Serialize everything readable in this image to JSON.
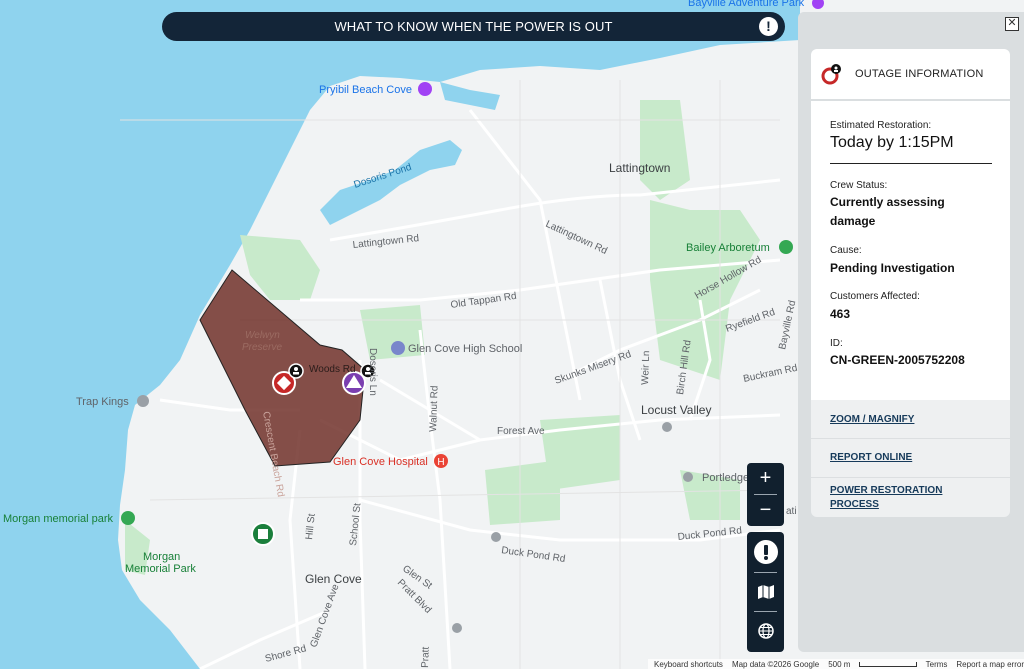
{
  "banner": {
    "text": "WHAT TO KNOW WHEN THE POWER IS OUT",
    "icon": "alert-icon"
  },
  "panel": {
    "close_icon": "close-icon",
    "header_icon": "outage-icon",
    "title": "OUTAGE INFORMATION",
    "estimated_label": "Estimated Restoration:",
    "estimated_value": "Today by 1:15PM",
    "crew_label": "Crew Status:",
    "crew_value": "Currently assessing damage",
    "cause_label": "Cause:",
    "cause_value": "Pending Investigation",
    "customers_label": "Customers Affected:",
    "customers_value": "463",
    "id_label": "ID:",
    "id_value": "CN-GREEN-2005752208",
    "links": [
      "ZOOM / MAGNIFY",
      "REPORT ONLINE",
      "POWER RESTORATION PROCESS"
    ]
  },
  "controls": {
    "zoom_in": "+",
    "zoom_out": "−",
    "tools": [
      "alert-icon",
      "map-layers-icon",
      "globe-icon"
    ]
  },
  "map": {
    "places": {
      "lattingtown": "Lattingtown",
      "locust_valley": "Locust Valley",
      "glen_cove": "Glen Cove",
      "portledge": "Portledge"
    },
    "pois": {
      "pryibil": "Pryibil Beach Cove",
      "bayville": "Bayville Adventure Park",
      "high_school": "Glen Cove High School",
      "hospital": "Glen Cove Hospital",
      "trap_kings": "Trap Kings",
      "morgan_park": "Morgan memorial park",
      "morgan_memorial_1": "Morgan",
      "morgan_memorial_2": "Memorial Park",
      "bailey_arboretum": "Bailey Arboretum",
      "welwyn_1": "Welwyn",
      "welwyn_2": "Preserve",
      "dosoris_pond": "Dosoris Pond"
    },
    "roads": {
      "lattingtown_rd": "Lattingtown Rd",
      "lattingtown_rd2": "Lattingtown Rd",
      "old_tappan": "Old Tappan Rd",
      "skunks_misery": "Skunks Misery Rd",
      "horse_hollow": "Horse Hollow Rd",
      "ryefield": "Ryefield Rd",
      "bayville_rd": "Bayville Rd",
      "buckram": "Buckram Rd",
      "birch_hill": "Birch Hill Rd",
      "weir_ln": "Weir Ln",
      "forest_ave": "Forest Ave",
      "walnut_rd": "Walnut Rd",
      "duck_pond_1": "Duck Pond Rd",
      "duck_pond_2": "Duck Pond Rd",
      "school_st": "School St",
      "hill_st": "Hill St",
      "glen_st": "Glen St",
      "pratt_blvd": "Pratt Blvd",
      "glen_cove_ave": "Glen Cove Ave",
      "shore_rd": "Shore Rd",
      "crescent_beach": "Crescent Beach Rd",
      "woods_rd": "Woods Rd",
      "dosoris_ln": "Dosoris Ln",
      "pratt": "Pratt",
      "ati": "ati"
    }
  },
  "attribution": {
    "shortcuts": "Keyboard shortcuts",
    "data": "Map data ©2026 Google",
    "scale": "500 m",
    "terms": "Terms",
    "report": "Report a map error"
  },
  "colors": {
    "water": "#8fd3ee",
    "land": "#f1f3f4",
    "park": "#c8eacb",
    "outage_fill": "#6b2a22",
    "banner": "#132538",
    "panel_bg": "#dadee0"
  }
}
